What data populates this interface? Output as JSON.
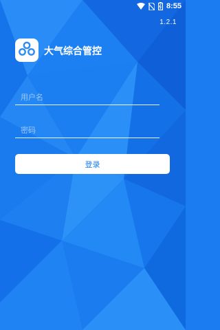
{
  "status_bar": {
    "time": "8:55",
    "icons": [
      "wifi-icon",
      "no-sim-icon",
      "battery-icon"
    ]
  },
  "app": {
    "version": "1.2.1",
    "title": "大气综合管控",
    "logo_icon": "network-nodes-icon"
  },
  "login_form": {
    "username_placeholder": "用户名",
    "password_placeholder": "密码",
    "login_label": "登录"
  },
  "colors": {
    "background": "#1a7cf0",
    "accent": "#1a7cf0",
    "logo": "#2f8cf4",
    "text": "#ffffff"
  }
}
